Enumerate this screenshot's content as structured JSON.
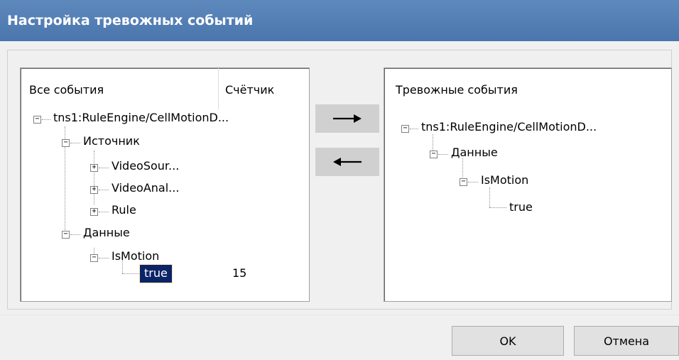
{
  "window": {
    "title": "Настройка тревожных событий"
  },
  "all_events": {
    "header_events": "Все события",
    "header_counter": "Счётчик",
    "tree": {
      "root": "tns1:RuleEngine/CellMotionD...",
      "source": "Источник",
      "video_source": "VideoSour...",
      "video_analytics": "VideoAnal...",
      "rule": "Rule",
      "data": "Данные",
      "is_motion": "IsMotion",
      "true_value": "true",
      "true_count": "15"
    }
  },
  "alarm_events": {
    "header": "Тревожные события",
    "tree": {
      "root": "tns1:RuleEngine/CellMotionD...",
      "data": "Данные",
      "is_motion": "IsMotion",
      "true_value": "true"
    }
  },
  "buttons": {
    "add_icon": "arrow-right-icon",
    "remove_icon": "arrow-left-icon",
    "ok": "OK",
    "cancel": "Отмена"
  },
  "tree_toggle": {
    "expanded": "−",
    "collapsed": "+"
  },
  "colors": {
    "title_bar": "#4f7bb3",
    "selection": "#0b2367"
  }
}
